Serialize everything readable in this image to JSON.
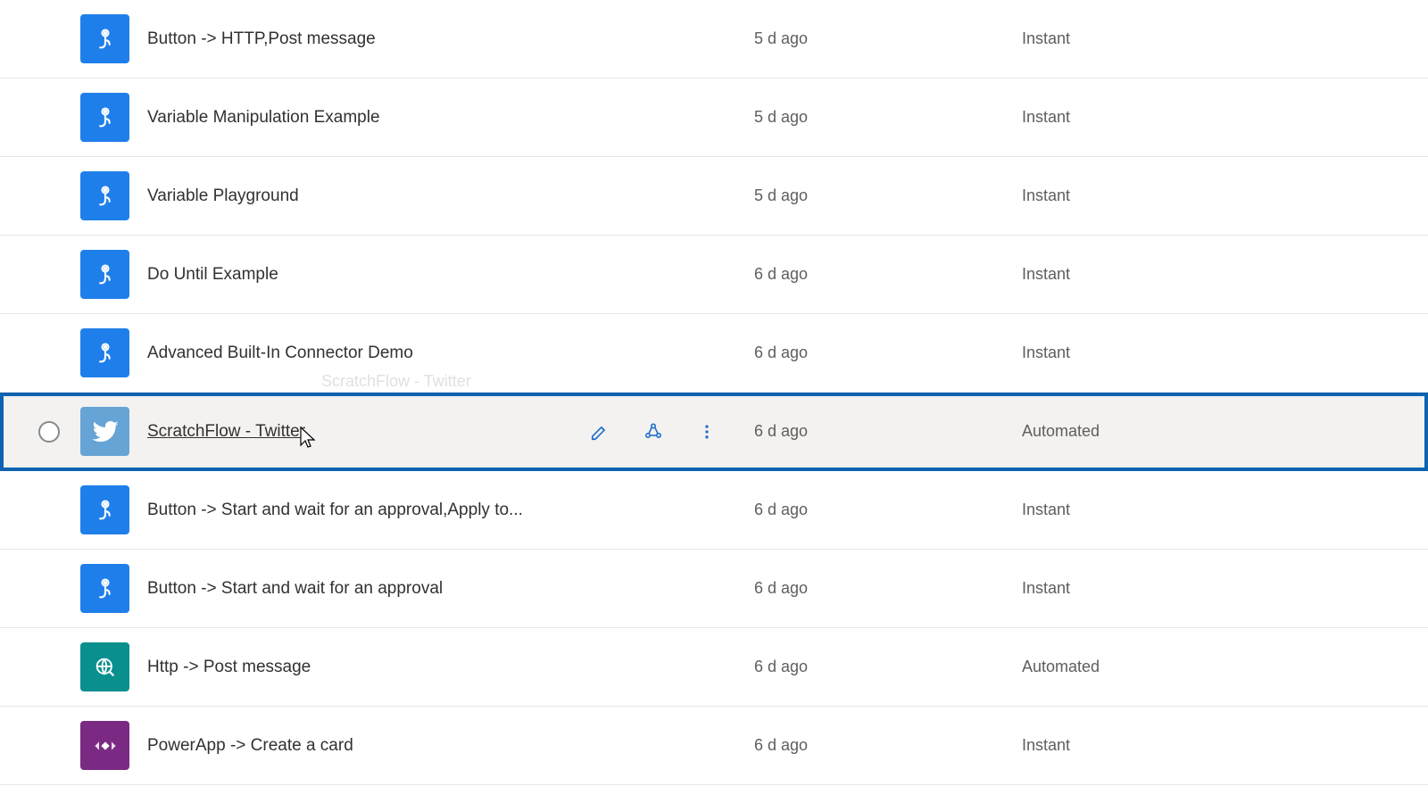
{
  "flows": [
    {
      "name": "Button -> HTTP,Post message",
      "modified": "5 d ago",
      "type": "Instant",
      "icon": "touch",
      "tile": "blue"
    },
    {
      "name": "Variable Manipulation Example",
      "modified": "5 d ago",
      "type": "Instant",
      "icon": "touch",
      "tile": "blue"
    },
    {
      "name": "Variable Playground",
      "modified": "5 d ago",
      "type": "Instant",
      "icon": "touch",
      "tile": "blue"
    },
    {
      "name": "Do Until Example",
      "modified": "6 d ago",
      "type": "Instant",
      "icon": "touch",
      "tile": "blue"
    },
    {
      "name": "Advanced Built-In Connector Demo",
      "modified": "6 d ago",
      "type": "Instant",
      "icon": "touch",
      "tile": "blue"
    },
    {
      "name": "ScratchFlow - Twitter",
      "modified": "6 d ago",
      "type": "Automated",
      "icon": "twitter",
      "tile": "twitter",
      "hovered": true
    },
    {
      "name": "Button -> Start and wait for an approval,Apply to...",
      "modified": "6 d ago",
      "type": "Instant",
      "icon": "touch",
      "tile": "blue"
    },
    {
      "name": "Button -> Start and wait for an approval",
      "modified": "6 d ago",
      "type": "Instant",
      "icon": "touch",
      "tile": "blue"
    },
    {
      "name": "Http -> Post message",
      "modified": "6 d ago",
      "type": "Automated",
      "icon": "globe",
      "tile": "teal"
    },
    {
      "name": "PowerApp -> Create a card",
      "modified": "6 d ago",
      "type": "Instant",
      "icon": "diamond",
      "tile": "purple"
    }
  ],
  "ghost_label": "ScratchFlow - Twitter"
}
